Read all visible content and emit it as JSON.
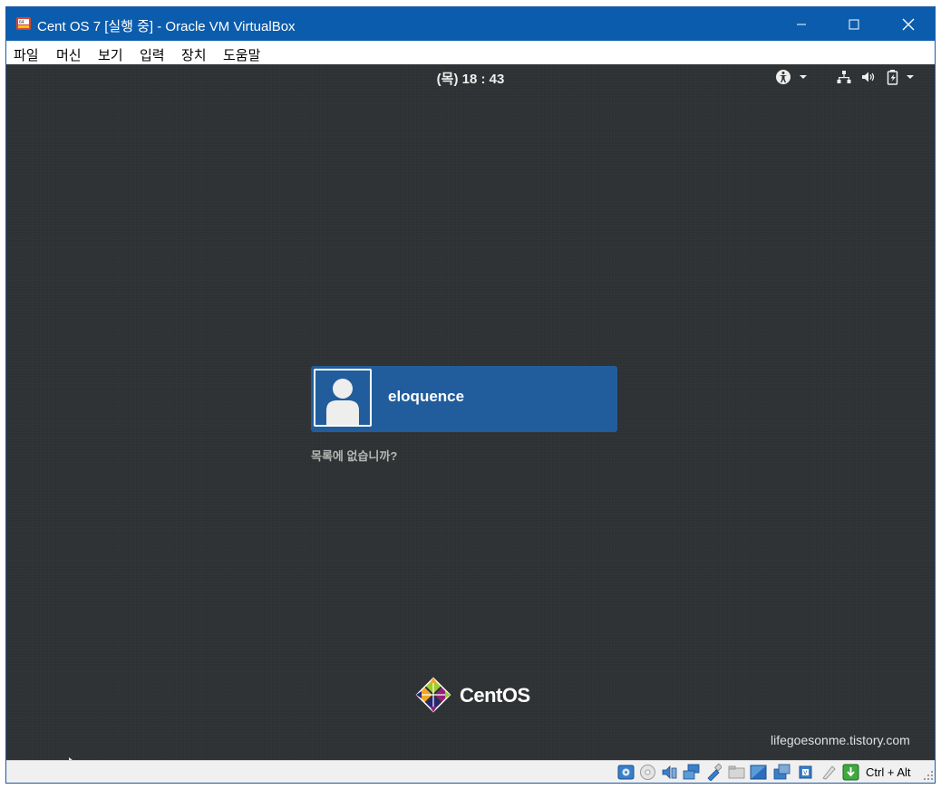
{
  "window": {
    "title": "Cent OS 7 [실행 중] - Oracle VM VirtualBox",
    "controls": {
      "minimize": "─",
      "maximize": "☐",
      "close": "✕"
    }
  },
  "menubar": {
    "items": [
      "파일",
      "머신",
      "보기",
      "입력",
      "장치",
      "도움말"
    ]
  },
  "gnome": {
    "clock": "(목) 18 : 43",
    "top_icons": [
      "accessibility-icon",
      "network-wired-icon",
      "volume-icon",
      "battery-icon"
    ],
    "user": {
      "name": "eloquence"
    },
    "not_listed": "목록에 없습니까?",
    "logo_text": "CentOS",
    "watermark": "lifegoesonme.tistory.com"
  },
  "statusbar": {
    "icons": [
      "hard-disk-icon",
      "optical-drive-icon",
      "audio-icon",
      "network-icon",
      "usb-icon",
      "shared-folders-icon",
      "display-icon",
      "video-capture-icon",
      "drag-drop-icon",
      "cpu-virtualization-icon",
      "mouse-integration-icon",
      "host-key-icon"
    ],
    "host_key": "Ctrl + Alt"
  },
  "colors": {
    "titlebar": "#0b5cad",
    "screen": "#2e3133",
    "user_card": "#215d9c",
    "not_listed_text": "#b6b8b4"
  }
}
